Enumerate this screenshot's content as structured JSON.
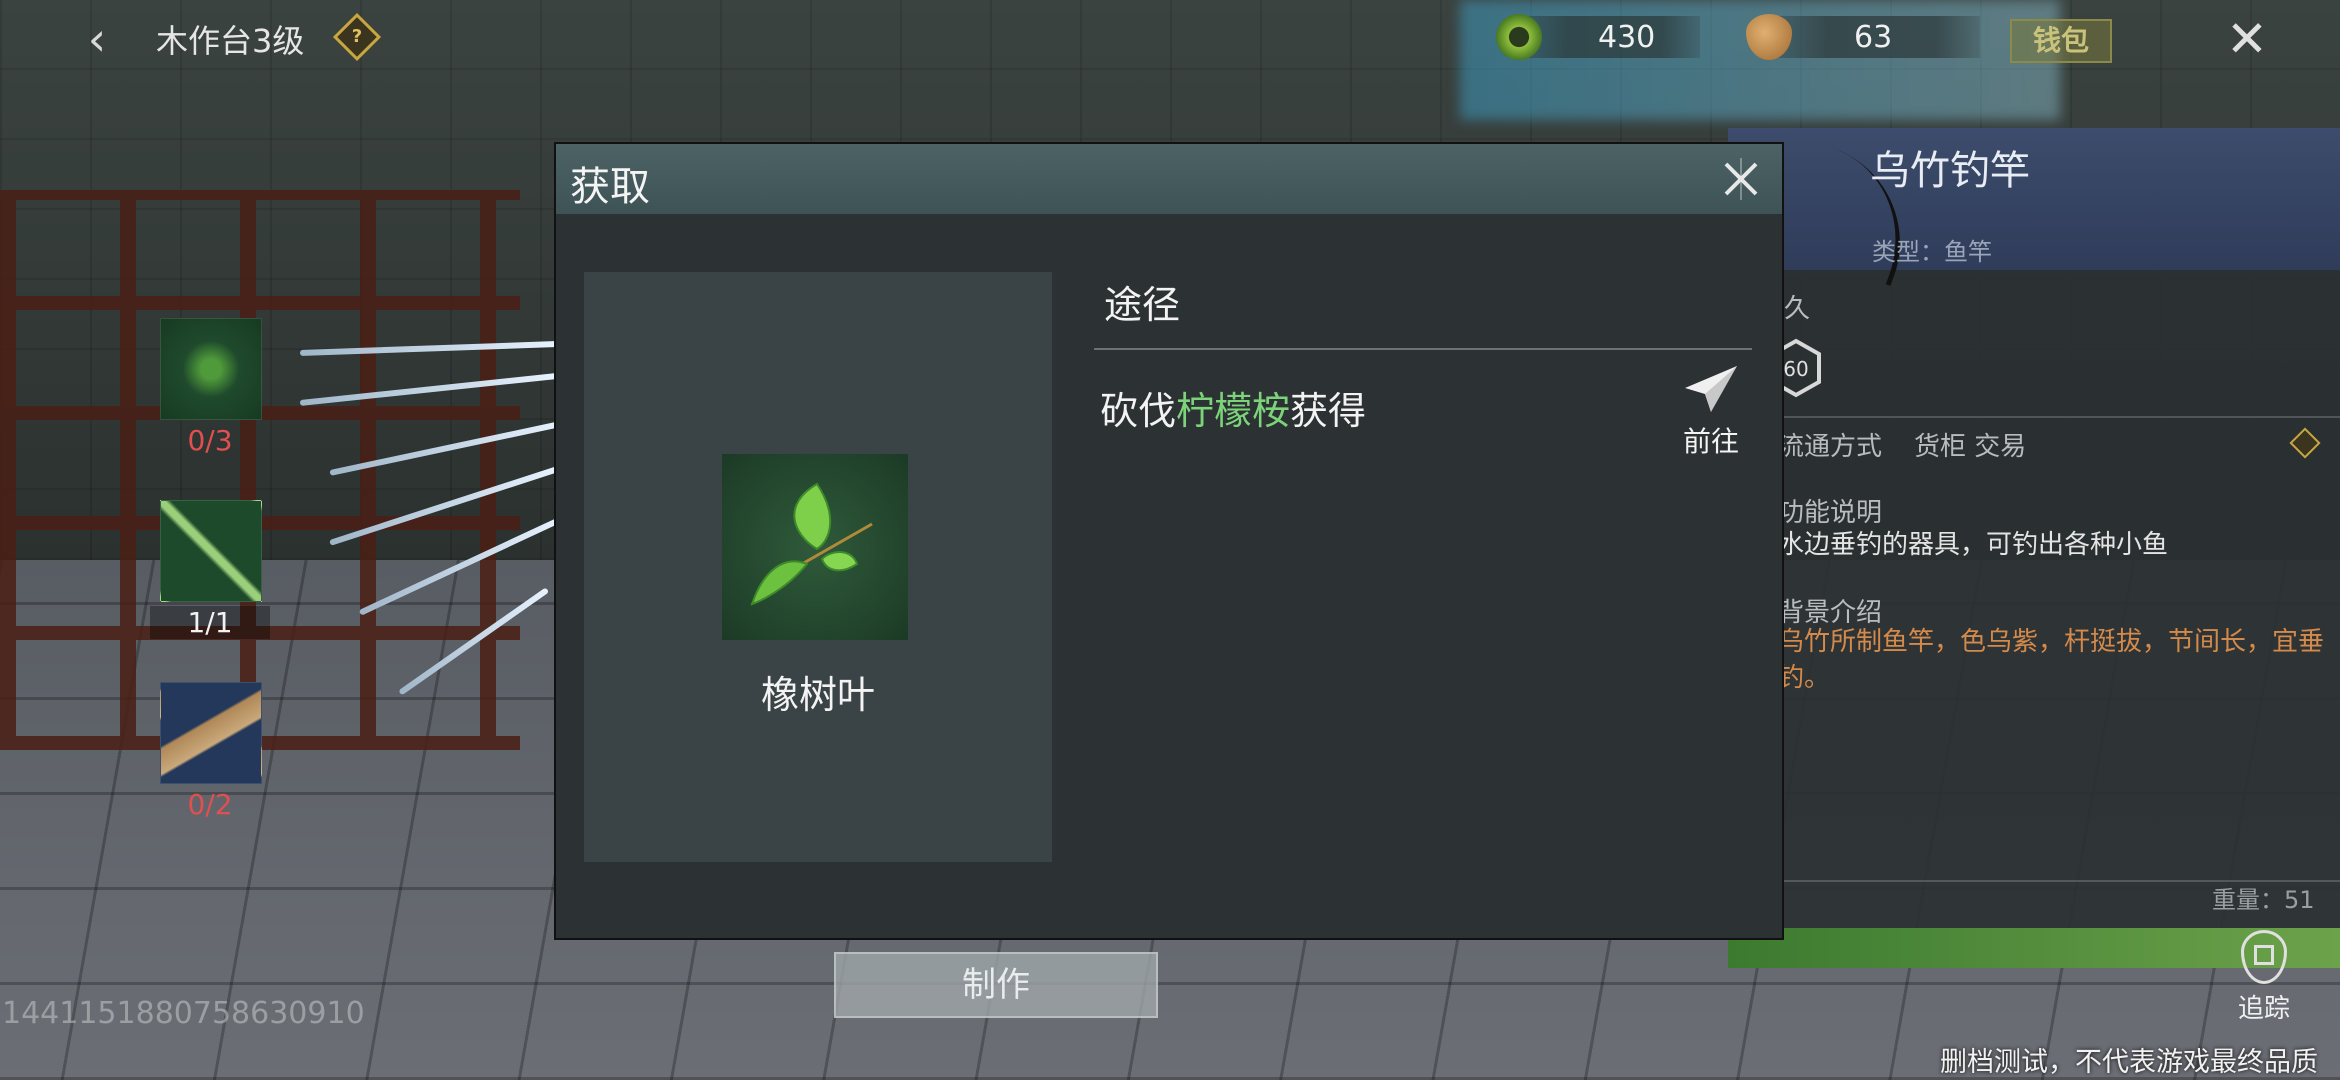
{
  "topbar": {
    "station_title": "木作台3级",
    "help_glyph": "?",
    "currency_1_value": "430",
    "currency_2_value": "63",
    "wallet_label": "钱包"
  },
  "materials": [
    {
      "count": "0/3",
      "status": "insufficient"
    },
    {
      "count": "1/1",
      "status": "ok"
    },
    {
      "count": "0/2",
      "status": "insufficient"
    }
  ],
  "info_panel": {
    "item_name": "乌竹钓竿",
    "item_type": "类型：鱼竿",
    "durability_label": "久",
    "durability_value": "60",
    "circulation_label": "流通方式",
    "circulation_value": "货柜 交易",
    "function_label": "功能说明",
    "function_text": "水边垂钓的器具，可钓出各种小鱼",
    "story_label": "背景介绍",
    "story_text": "乌竹所制鱼竿，色乌紫，杆挺拔，节间长，宜垂钓。",
    "weight": "重量：51"
  },
  "modal": {
    "title": "获取",
    "item_name": "橡树叶",
    "path_title": "途径",
    "path_prefix": "砍伐",
    "path_highlight": "柠檬桉",
    "path_suffix": "获得",
    "go_label": "前往"
  },
  "craft_label": "制作",
  "user_id": "1441151880758630910",
  "track_label": "追踪",
  "disclaimer": "删档测试，不代表游戏最终品质",
  "colors": {
    "highlight_green": "#7cd37a",
    "insufficient_red": "#e05050",
    "story_orange": "#d48a4a",
    "modal_header": "#4c6265",
    "info_header": "#3d4c6c"
  },
  "icons": [
    "back-arrow-icon",
    "help-diamond-icon",
    "jade-coin-icon",
    "copper-coin-icon",
    "close-x-icon",
    "leaf-icon",
    "bamboo-icon",
    "wood-plank-icon",
    "fishing-rod-icon",
    "hexagon-icon",
    "paper-plane-icon",
    "track-pin-icon"
  ]
}
